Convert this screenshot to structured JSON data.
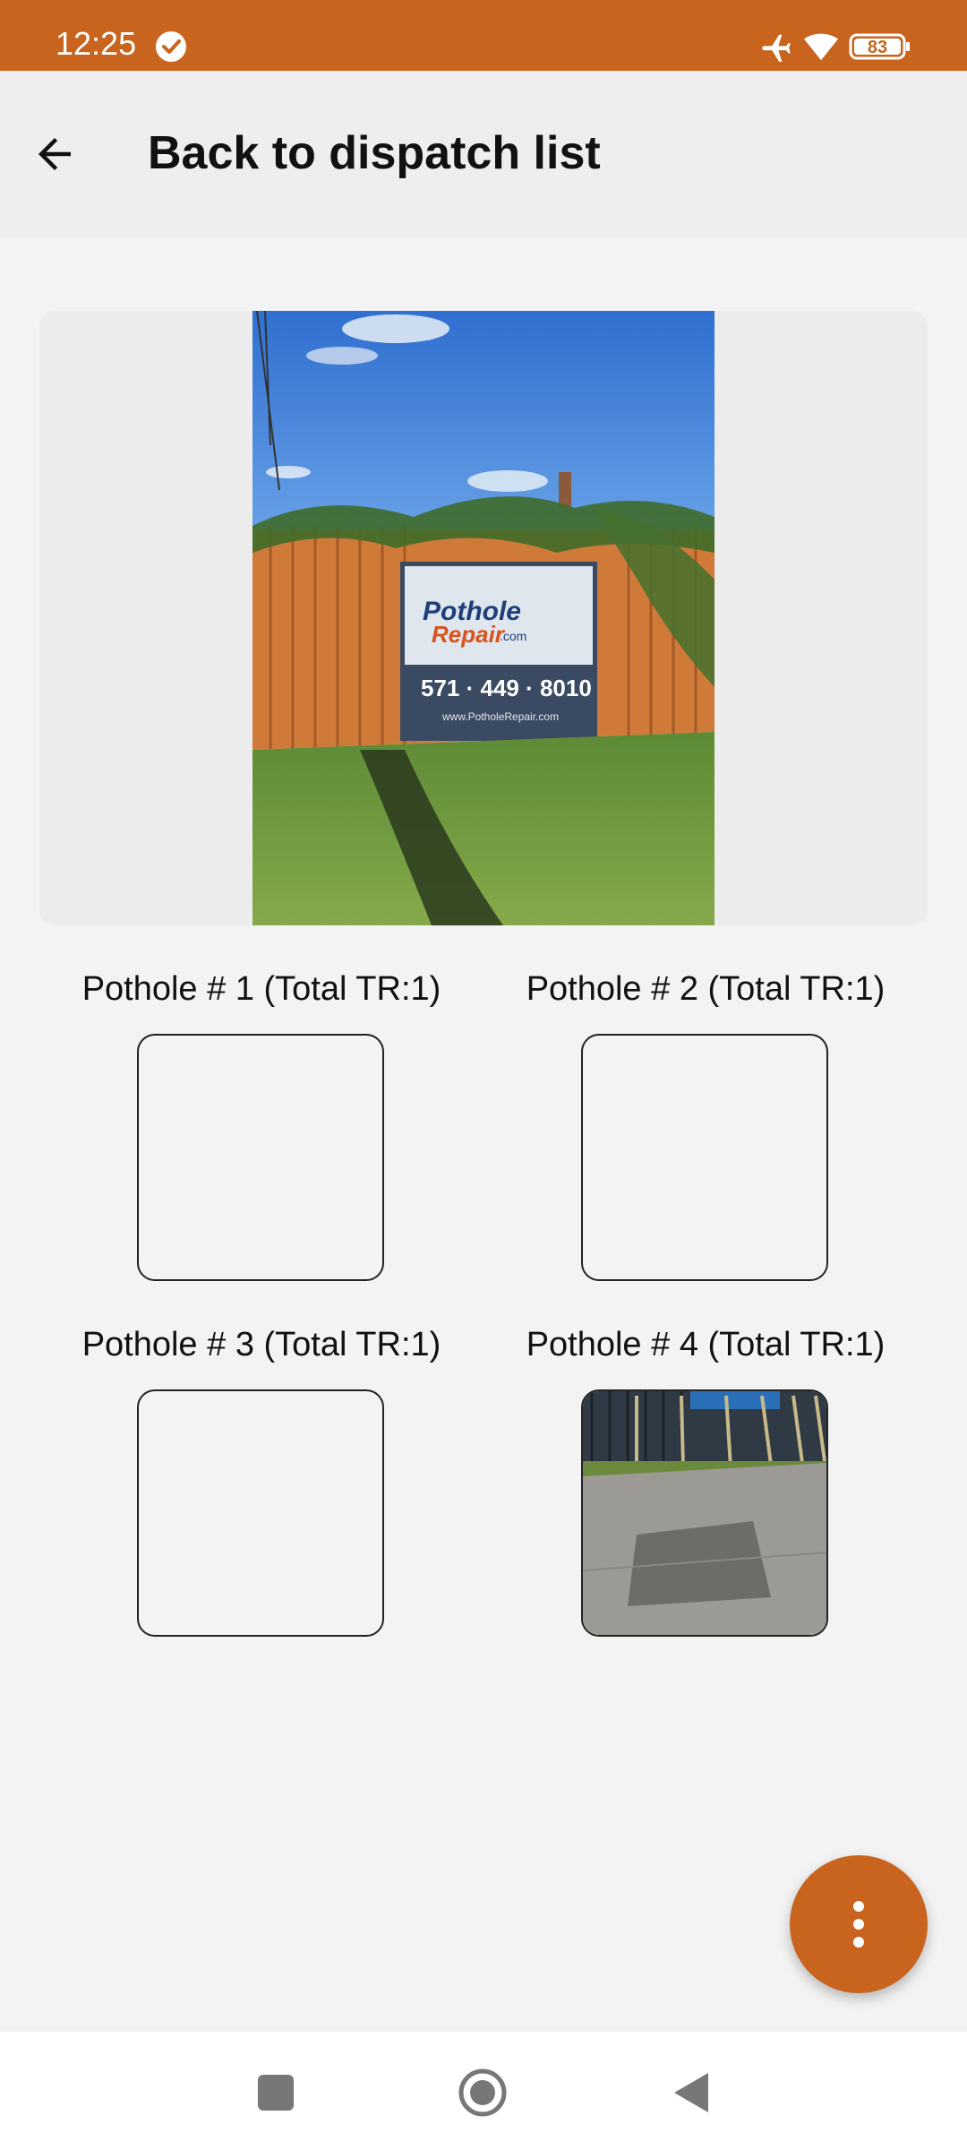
{
  "status_bar": {
    "time": "12:25",
    "battery": "83",
    "icons": [
      "check-circle-icon",
      "airplane-icon",
      "wifi-icon",
      "battery-icon"
    ],
    "background": "#c8641e"
  },
  "header": {
    "title": "Back to dispatch list",
    "back_icon": "arrow-left-icon"
  },
  "main_photo": {
    "phone": "571 · 449 · 8010",
    "sign_brand_line1": "Pothole",
    "sign_brand_line2": "Repair",
    "sign_brand_suffix": ".com",
    "sign_url": "www.PotholeRepair.com"
  },
  "potholes": [
    {
      "label": "Pothole # 1 (Total TR:1)",
      "has_photo": false
    },
    {
      "label": "Pothole # 2 (Total TR:1)",
      "has_photo": false
    },
    {
      "label": "Pothole # 3 (Total TR:1)",
      "has_photo": false
    },
    {
      "label": "Pothole # 4 (Total TR:1)",
      "has_photo": true
    }
  ],
  "fab": {
    "icon": "more-vertical-icon",
    "color": "#c8641e"
  },
  "nav_bar": {
    "icons": [
      "recents-icon",
      "home-icon",
      "back-icon"
    ]
  }
}
